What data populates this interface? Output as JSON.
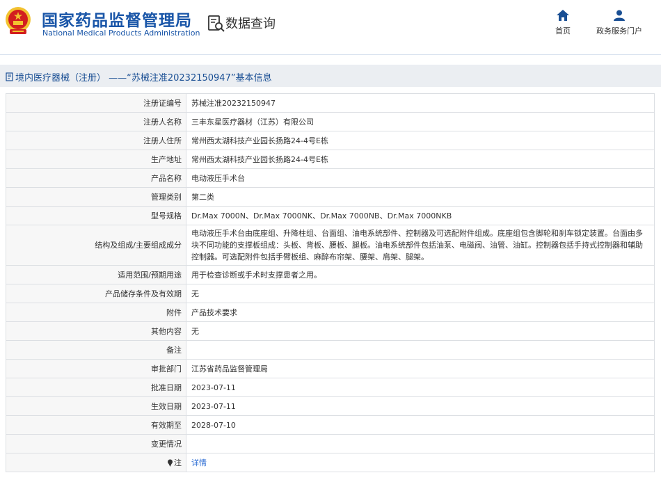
{
  "header": {
    "site_title": "国家药品监督管理局",
    "site_subtitle": "National Medical Products Administration",
    "query_title": "数据查询",
    "nav": {
      "home_label": "首页",
      "portal_label": "政务服务门户"
    }
  },
  "breadcrumb": {
    "text": "境内医疗器械（注册） ——“苏械注准20232150947”基本信息"
  },
  "record": [
    {
      "label": "注册证编号",
      "value": "苏械注准20232150947"
    },
    {
      "label": "注册人名称",
      "value": "三丰东星医疗器材（江苏）有限公司"
    },
    {
      "label": "注册人住所",
      "value": "常州西太湖科技产业园长扬路24-4号E栋"
    },
    {
      "label": "生产地址",
      "value": "常州西太湖科技产业园长扬路24-4号E栋"
    },
    {
      "label": "产品名称",
      "value": "电动液压手术台"
    },
    {
      "label": "管理类别",
      "value": "第二类"
    },
    {
      "label": "型号规格",
      "value": "Dr.Max 7000N、Dr.Max 7000NK、Dr.Max 7000NB、Dr.Max 7000NKB"
    },
    {
      "label": "结构及组成/主要组成成分",
      "value": "电动液压手术台由底座组、升降柱组、台面组、油电系统部件、控制器及可选配附件组成。底座组包含脚轮和刹车锁定装置。台面由多块不同功能的支撑板组成：头板、背板、腰板、腿板。油电系统部件包括油泵、电磁阀、油管、油缸。控制器包括手持式控制器和辅助控制器。可选配附件包括手臂板组、麻醉布帘架、腰架、肩架、腿架。"
    },
    {
      "label": "适用范围/预期用途",
      "value": "用于检查诊断或手术时支撑患者之用。"
    },
    {
      "label": "产品储存条件及有效期",
      "value": "无"
    },
    {
      "label": "附件",
      "value": "产品技术要求"
    },
    {
      "label": "其他内容",
      "value": "无"
    },
    {
      "label": "备注",
      "value": ""
    },
    {
      "label": "审批部门",
      "value": "江苏省药品监督管理局"
    },
    {
      "label": "批准日期",
      "value": "2023-07-11"
    },
    {
      "label": "生效日期",
      "value": "2023-07-11"
    },
    {
      "label": "有效期至",
      "value": "2028-07-10"
    },
    {
      "label": "变更情况",
      "value": ""
    },
    {
      "label": "注",
      "value": "详情"
    }
  ],
  "colors": {
    "brand_blue": "#1a56a8",
    "link_blue": "#2a6bd3",
    "emblem_red": "#d21f1f",
    "emblem_gold": "#f2c230"
  }
}
